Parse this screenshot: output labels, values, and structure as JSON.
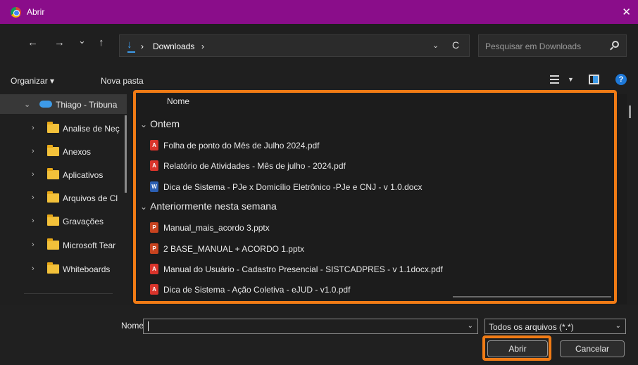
{
  "window": {
    "title": "Abrir",
    "close_glyph": "✕"
  },
  "nav": {
    "back": "←",
    "forward": "→",
    "recent": "⌄",
    "up": "↑",
    "breadcrumb": [
      "›",
      "Downloads",
      "›"
    ],
    "address_dropdown": "⌄",
    "refresh": "C",
    "search_placeholder": "Pesquisar em Downloads"
  },
  "toolbar": {
    "organize": "Organizar ▾",
    "new_folder": "Nova pasta",
    "view_dropdown": "▼",
    "help": "?"
  },
  "sidebar": {
    "root": {
      "chevron": "⌄",
      "label": "Thiago - Tribuna"
    },
    "items": [
      {
        "chevron": "›",
        "label": "Analise de Neç"
      },
      {
        "chevron": "›",
        "label": "Anexos"
      },
      {
        "chevron": "›",
        "label": "Aplicativos"
      },
      {
        "chevron": "›",
        "label": "Arquivos de Cl"
      },
      {
        "chevron": "›",
        "label": "Gravações"
      },
      {
        "chevron": "›",
        "label": "Microsoft Tear"
      },
      {
        "chevron": "›",
        "label": "Whiteboards"
      }
    ]
  },
  "filelist": {
    "column_header": "Nome",
    "groups": [
      {
        "chevron": "⌄",
        "label": "Ontem",
        "files": [
          {
            "type": "pdf",
            "icon_glyph": "A",
            "name": "Folha de ponto do Mês de Julho 2024.pdf"
          },
          {
            "type": "pdf",
            "icon_glyph": "A",
            "name": "Relatório de Atividades - Mês de julho - 2024.pdf"
          },
          {
            "type": "docx",
            "icon_glyph": "W",
            "name": "Dica de Sistema - PJe x Domicílio Eletrônico -PJe e CNJ - v 1.0.docx"
          }
        ]
      },
      {
        "chevron": "⌄",
        "label": "Anteriormente nesta semana",
        "files": [
          {
            "type": "pptx",
            "icon_glyph": "P",
            "name": "Manual_mais_acordo 3.pptx"
          },
          {
            "type": "pptx",
            "icon_glyph": "P",
            "name": "2 BASE_MANUAL + ACORDO 1.pptx"
          },
          {
            "type": "pdf",
            "icon_glyph": "A",
            "name": "Manual do Usuário - Cadastro Presencial - SISTCADPRES - v 1.1docx.pdf"
          },
          {
            "type": "pdf",
            "icon_glyph": "A",
            "name": "Dica de Sistema - Ação Coletiva - eJUD - v1.0.pdf"
          }
        ]
      }
    ]
  },
  "footer": {
    "name_label": "Nome:",
    "name_value": "",
    "name_dropdown": "⌄",
    "filter_value": "Todos os arquivos (*.*)",
    "filter_dropdown": "⌄",
    "open_label": "Abrir",
    "cancel_label": "Cancelar"
  },
  "colors": {
    "titlebar": "#8a0d8a",
    "highlight": "#f07b15",
    "accent": "#3d9be9"
  }
}
